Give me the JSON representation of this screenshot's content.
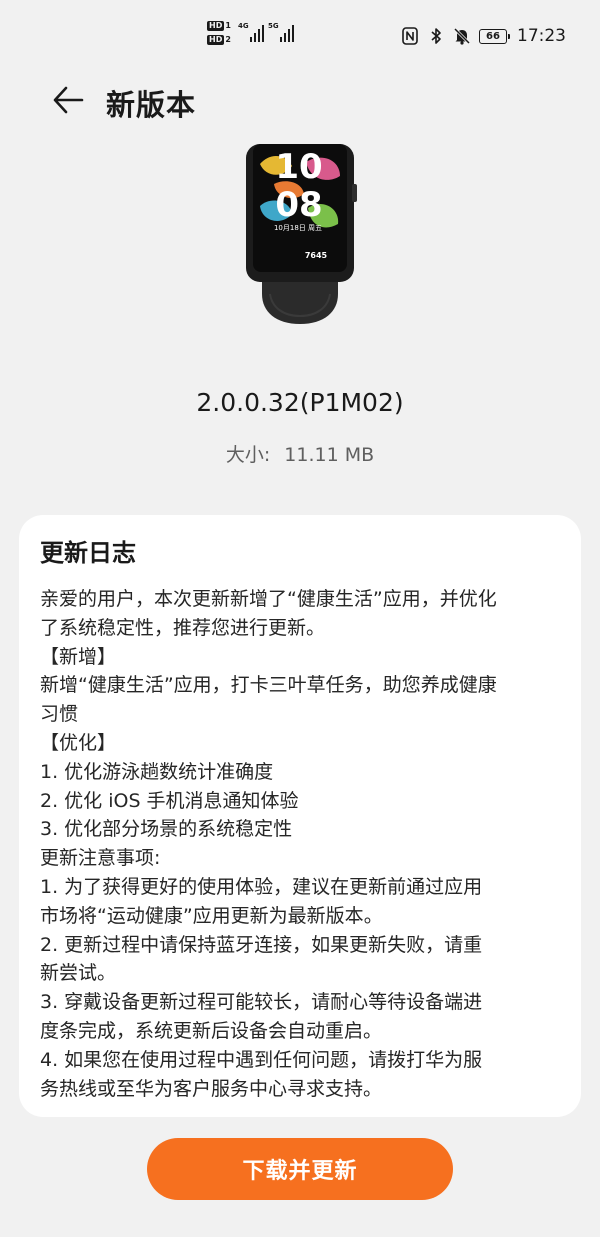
{
  "status_bar": {
    "sim1_label": "1",
    "sim2_label": "2",
    "hd_label": "HD",
    "sim1_network": "4G",
    "sim2_network": "5G",
    "battery_level": "66",
    "time": "17:23"
  },
  "header": {
    "title": "新版本"
  },
  "device": {
    "watch_hour": "10",
    "watch_minute": "08",
    "watch_date": "10月18日 周五",
    "watch_steps": "7645"
  },
  "version": {
    "number": "2.0.0.32(P1M02)",
    "size_label": "大小:",
    "size_value": "11.11 MB"
  },
  "changelog": {
    "title": "更新日志",
    "lines": [
      "亲爱的用户，本次更新新增了“健康生活”应用，并优化",
      "了系统稳定性，推荐您进行更新。",
      "【新增】",
      "新增“健康生活”应用，打卡三叶草任务，助您养成健康",
      "习惯",
      "【优化】",
      "1. 优化游泳趟数统计准确度",
      "2. 优化 iOS 手机消息通知体验",
      "3. 优化部分场景的系统稳定性",
      "更新注意事项:",
      "1. 为了获得更好的使用体验，建议在更新前通过应用",
      "市场将“运动健康”应用更新为最新版本。",
      "2. 更新过程中请保持蓝牙连接，如果更新失败，请重",
      "新尝试。",
      "3. 穿戴设备更新过程可能较长，请耐心等待设备端进",
      "度条完成，系统更新后设备会自动重启。",
      "4. 如果您在使用过程中遇到任何问题，请拨打华为服",
      "务热线或至华为客户服务中心寻求支持。"
    ]
  },
  "actions": {
    "download_label": "下载并更新"
  },
  "colors": {
    "background": "#f1f1f1",
    "card": "#ffffff",
    "accent": "#f6701f",
    "secondary_text": "#5f5f5f"
  },
  "icons": {
    "back": "arrow-left-icon",
    "nfc": "nfc-icon",
    "bluetooth": "bluetooth-icon",
    "mute": "bell-off-icon",
    "battery": "battery-icon"
  }
}
